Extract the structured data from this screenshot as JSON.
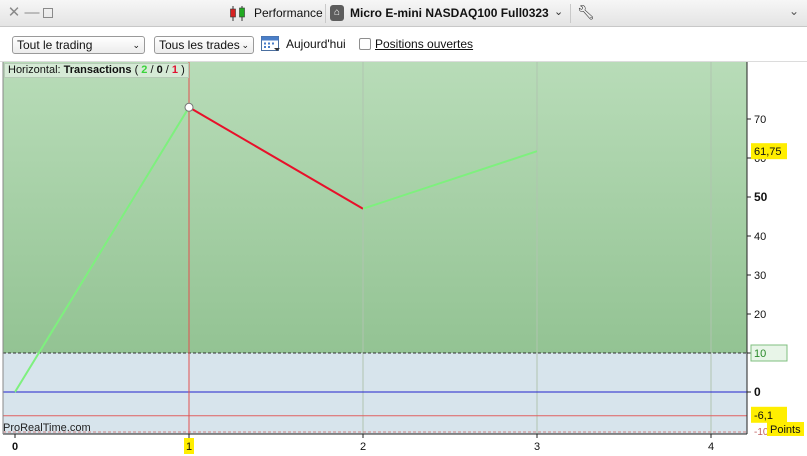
{
  "titlebar": {
    "panel_title": "Performance",
    "instrument": "Micro E-mini NASDAQ100 Full0323"
  },
  "toolbar": {
    "trading_select": "Tout le trading",
    "trades_select": "Tous les trades",
    "today_label": "Aujourd'hui",
    "open_positions_label": "Positions ouvertes",
    "open_positions_checked": false
  },
  "chart_header": {
    "prefix": "Horizontal:",
    "name": "Transactions",
    "open_paren": "(",
    "wins": "2",
    "sep1": " / ",
    "neutral": "0",
    "sep2": " / ",
    "losses": "1",
    "close_paren": ")"
  },
  "brand": "ProRealTime.com",
  "colors": {
    "gain_fill": "#b3d9b3",
    "loss_zone": "#d7e4ec",
    "up_line": "#7ef07e",
    "down_line": "#e8102a",
    "zero_line": "#2222cc",
    "badge": "#ffee00"
  },
  "chart_data": {
    "type": "line",
    "x": [
      0,
      1,
      2,
      3
    ],
    "y": [
      0,
      73,
      47,
      61.75
    ],
    "xlim": [
      0,
      4.2
    ],
    "ylim": [
      -11,
      81
    ],
    "x_ticks": [
      "0",
      "1",
      "2",
      "3",
      "4"
    ],
    "y_ticks": [
      "0",
      "10",
      "20",
      "30",
      "40",
      "50",
      "60",
      "70"
    ],
    "bold_y_ticks": [
      "0",
      "50"
    ],
    "highlight_x_tick": "1",
    "threshold_top": 10,
    "threshold_bottom": -10,
    "last_value_label": "61,75",
    "drawdown_label": "-6,1",
    "drawdown": -6.1,
    "top_threshold_label": "10",
    "bottom_threshold_label": "-10",
    "unit_label": "Points",
    "cursor_x": 1
  }
}
